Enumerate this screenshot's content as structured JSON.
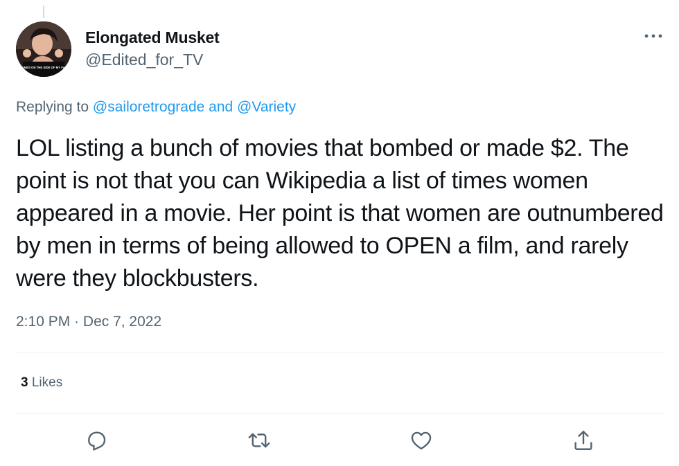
{
  "author": {
    "display_name": "Elongated Musket",
    "handle": "@Edited_for_TV",
    "avatar_caption": "FLAMES ON THE SIDE OF MY FACE"
  },
  "reply": {
    "prefix": "Replying to",
    "user1": "@sailoretrograde",
    "conjunction": "and",
    "user2": "@Variety"
  },
  "tweet": {
    "text": "LOL listing a bunch of movies that bombed or made $2. The point is not that you can Wikipedia a list of times women appeared in a movie. Her point is that women are outnumbered by men in terms of being allowed to OPEN a film, and rarely were they blockbusters."
  },
  "meta": {
    "time": "2:10 PM",
    "separator": "·",
    "date": "Dec 7, 2022"
  },
  "stats": {
    "likes_count": "3",
    "likes_label": "Likes"
  },
  "icons": {
    "more": "more-icon",
    "reply": "reply-icon",
    "retweet": "retweet-icon",
    "like": "like-icon",
    "share": "share-icon"
  },
  "colors": {
    "link": "#1d9bf0",
    "secondary_text": "#536471",
    "primary_text": "#0f1419",
    "divider": "#eff3f4"
  }
}
